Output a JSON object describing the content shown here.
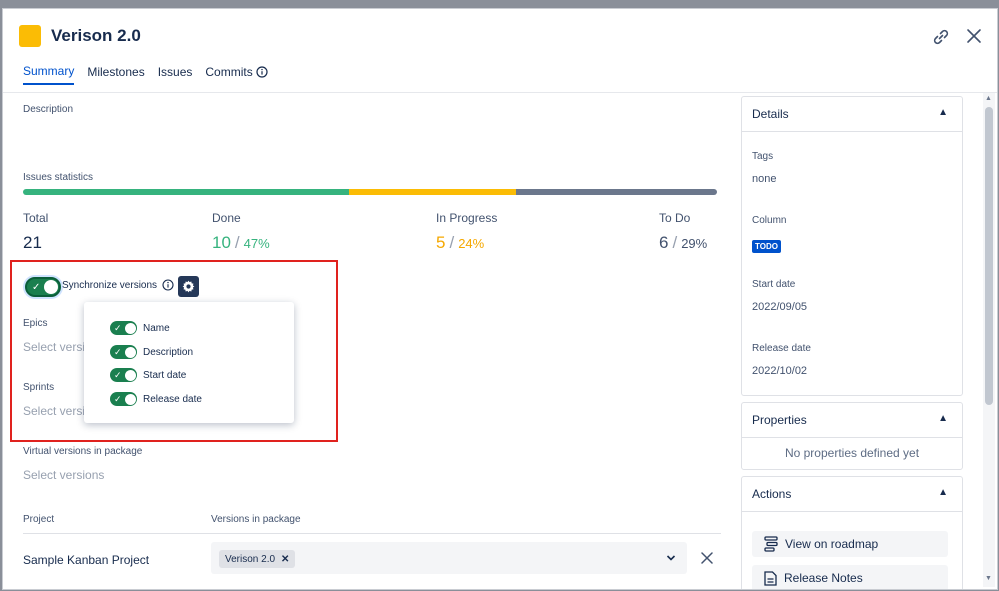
{
  "header": {
    "title": "Verison 2.0",
    "accent": "#fbbc05"
  },
  "tabs": [
    {
      "label": "Summary",
      "active": true
    },
    {
      "label": "Milestones",
      "active": false
    },
    {
      "label": "Issues",
      "active": false
    },
    {
      "label": "Commits",
      "active": false
    }
  ],
  "description_label": "Description",
  "issues_statistics": {
    "label": "Issues statistics",
    "done_pct": 47,
    "in_progress_pct": 24,
    "todo_pct": 29,
    "colors": {
      "done": "#36b37e",
      "in_progress": "#fbbc05",
      "todo": "#6b778c"
    },
    "total": {
      "label": "Total",
      "value": "21"
    },
    "done": {
      "label": "Done",
      "value": "10",
      "pct": "47%"
    },
    "in_progress": {
      "label": "In Progress",
      "value": "5",
      "pct": "24%"
    },
    "todo": {
      "label": "To Do",
      "value": "6",
      "pct": "29%"
    }
  },
  "sync": {
    "label": "Synchronize versions",
    "options": [
      "Name",
      "Description",
      "Start date",
      "Release date"
    ]
  },
  "epics": {
    "label": "Epics",
    "placeholder": "Select versio"
  },
  "sprints": {
    "label": "Sprints",
    "placeholder": "Select versio"
  },
  "virtual_versions": {
    "label": "Virtual versions in package",
    "placeholder": "Select versions"
  },
  "package_table": {
    "col_project": "Project",
    "col_versions": "Versions in package",
    "rows": [
      {
        "project": "Sample Kanban Project",
        "version": "Verison 2.0"
      }
    ]
  },
  "details": {
    "title": "Details",
    "tags_label": "Tags",
    "tags_value": "none",
    "column_label": "Column",
    "column_value": "TODO",
    "start_label": "Start date",
    "start_value": "2022/09/05",
    "release_label": "Release date",
    "release_value": "2022/10/02"
  },
  "properties": {
    "title": "Properties",
    "empty": "No properties defined yet"
  },
  "actions": {
    "title": "Actions",
    "roadmap": "View on roadmap",
    "release_notes": "Release Notes"
  }
}
